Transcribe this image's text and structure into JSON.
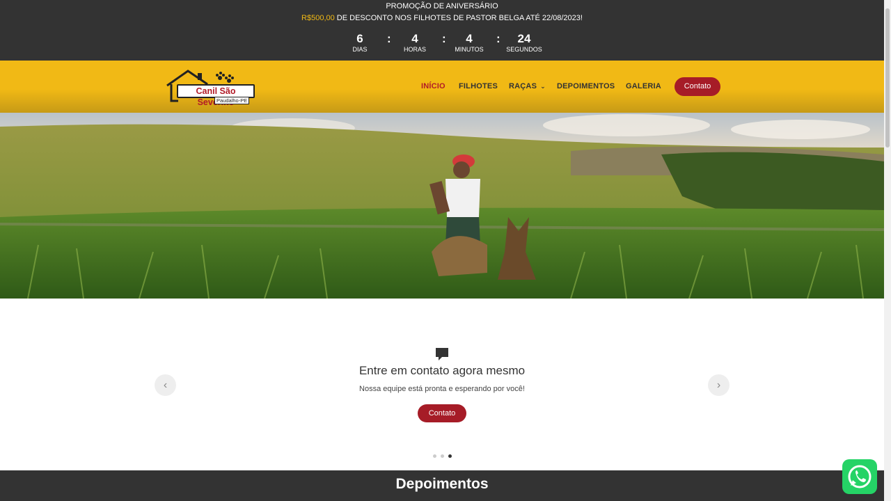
{
  "promo": {
    "title": "PROMOÇÃO DE ANIVERSÁRIO",
    "highlight": "R$500,00",
    "text": " DE DESCONTO NOS FILHOTES DE PASTOR BELGA ATÉ 22/08/2023!",
    "highlight_color": "#f1b915",
    "countdown": [
      {
        "value": "6",
        "label": "DIAS"
      },
      {
        "value": "4",
        "label": "HORAS"
      },
      {
        "value": "4",
        "label": "MINUTOS"
      },
      {
        "value": "24",
        "label": "SEGUNDOS"
      }
    ],
    "separator": ":"
  },
  "header": {
    "logo_text": "Canil São Severino",
    "logo_sub": "Paudalho-PE",
    "nav": [
      {
        "label": "INÍCIO",
        "active": true
      },
      {
        "label": "FILHOTES"
      },
      {
        "label": "RAÇAS",
        "dropdown": true
      },
      {
        "label": "DEPOIMENTOS"
      },
      {
        "label": "GALERIA"
      }
    ],
    "contact_label": "Contato",
    "colors": {
      "bar": "#f1b915",
      "accent": "#a61c27"
    }
  },
  "slider": {
    "title": "Entre em contato agora mesmo",
    "subtitle": "Nossa equipe está pronta e esperando por você!",
    "button_label": "Contato",
    "prev_icon": "‹",
    "next_icon": "›",
    "dots_count": 3,
    "active_dot": 3
  },
  "testimonials": {
    "title": "Depoimentos"
  },
  "icons": {
    "chat": "chat-bubble-icon",
    "whatsapp": "whatsapp-icon",
    "caret": "chevron-down-icon"
  }
}
